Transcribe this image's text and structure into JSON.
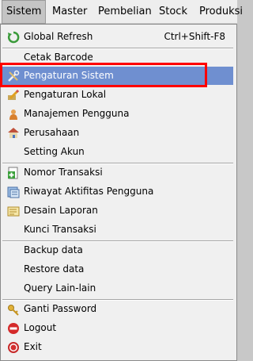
{
  "menubar": {
    "items": [
      {
        "label": "Sistem"
      },
      {
        "label": "Master"
      },
      {
        "label": "Pembelian"
      },
      {
        "label": "Stock"
      },
      {
        "label": "Produksi"
      }
    ]
  },
  "menu": {
    "items": [
      {
        "label": "Global Refresh",
        "shortcut": "Ctrl+Shift-F8",
        "icon": "refresh-icon"
      },
      {
        "label": "Cetak Barcode"
      },
      {
        "label": "Pengaturan Sistem",
        "icon": "tools-icon",
        "selected": true
      },
      {
        "label": "Pengaturan Lokal",
        "icon": "pencil-icon"
      },
      {
        "label": "Manajemen Pengguna",
        "icon": "user-icon"
      },
      {
        "label": "Perusahaan",
        "icon": "house-icon"
      },
      {
        "label": "Setting Akun"
      },
      {
        "label": "Nomor Transaksi",
        "icon": "add-document-icon"
      },
      {
        "label": "Riwayat Aktifitas Pengguna",
        "icon": "history-icon"
      },
      {
        "label": "Desain Laporan",
        "icon": "report-design-icon"
      },
      {
        "label": "Kunci Transaksi"
      },
      {
        "label": "Backup data"
      },
      {
        "label": "Restore data"
      },
      {
        "label": "Query Lain-lain"
      },
      {
        "label": "Ganti Password",
        "icon": "key-icon"
      },
      {
        "label": "Logout",
        "icon": "logout-icon"
      },
      {
        "label": "Exit",
        "icon": "exit-icon"
      }
    ]
  },
  "colors": {
    "selection": "#6f8fd0",
    "highlight_annotation": "#ff0000"
  }
}
